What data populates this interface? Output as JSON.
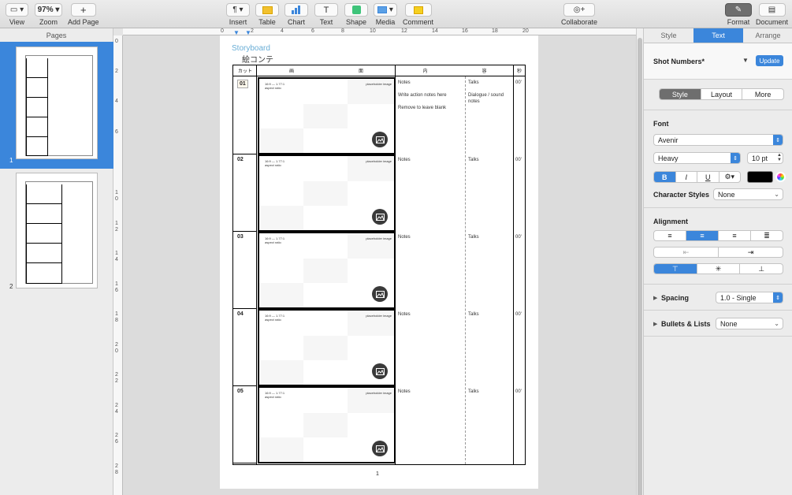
{
  "toolbar": {
    "view_label": "View",
    "zoom_value": "97%",
    "zoom_label": "Zoom",
    "add_page_label": "Add Page",
    "insert_label": "Insert",
    "table_label": "Table",
    "chart_label": "Chart",
    "text_label": "Text",
    "shape_label": "Shape",
    "media_label": "Media",
    "comment_label": "Comment",
    "collaborate_label": "Collaborate",
    "format_label": "Format",
    "document_label": "Document"
  },
  "pages_panel": {
    "title": "Pages",
    "page1_number": "1",
    "page2_number": "2"
  },
  "ruler_top": [
    "0",
    "2",
    "4",
    "6",
    "8",
    "10",
    "12",
    "14",
    "16",
    "18",
    "20"
  ],
  "ruler_left": [
    "0",
    "2",
    "4",
    "6",
    "10",
    "12",
    "14",
    "16",
    "18",
    "20",
    "22",
    "24",
    "26",
    "28"
  ],
  "document": {
    "title": "Storyboard",
    "subtitle": "絵コンテ",
    "headers": {
      "cut": "カット",
      "picture_1": "画",
      "picture_2": "面",
      "content_1": "内",
      "content_2": "容",
      "seconds": "秒"
    },
    "frame": {
      "ratio": "16:9 — 1.77:1",
      "ratio_sub": "aspect ratio",
      "placeholder": "placeholder image"
    },
    "rows": [
      {
        "cut": "01",
        "notes": "Notes",
        "notes2": "Write action notes here",
        "notes3": "Remove to leave blank",
        "talks": "Talks",
        "talks2": "Dialogue / sound notes",
        "seconds": "00'"
      },
      {
        "cut": "02",
        "notes": "Notes",
        "notes2": "",
        "notes3": "",
        "talks": "Talks",
        "talks2": "",
        "seconds": "00'"
      },
      {
        "cut": "03",
        "notes": "Notes",
        "notes2": "",
        "notes3": "",
        "talks": "Talks",
        "talks2": "",
        "seconds": "00'"
      },
      {
        "cut": "04",
        "notes": "Notes",
        "notes2": "",
        "notes3": "",
        "talks": "Talks",
        "talks2": "",
        "seconds": "00'"
      },
      {
        "cut": "05",
        "notes": "Notes",
        "notes2": "",
        "notes3": "",
        "talks": "Talks",
        "talks2": "",
        "seconds": "00'"
      }
    ],
    "page_number": "1"
  },
  "inspector": {
    "tabs": [
      "Style",
      "Text",
      "Arrange"
    ],
    "paragraph_style": "Shot Numbers*",
    "update_label": "Update",
    "subtabs": [
      "Style",
      "Layout",
      "More"
    ],
    "font_section": "Font",
    "font_family": "Avenir",
    "font_weight": "Heavy",
    "font_size": "10 pt",
    "bold": "B",
    "italic": "I",
    "underline": "U",
    "text_color": "#000000",
    "char_styles_label": "Character Styles",
    "char_styles_value": "None",
    "alignment_label": "Alignment",
    "spacing_label": "Spacing",
    "spacing_value": "1.0 - Single",
    "bullets_label": "Bullets & Lists",
    "bullets_value": "None"
  },
  "colors": {
    "accent": "#3b86db",
    "title_blue": "#6aaed6"
  }
}
